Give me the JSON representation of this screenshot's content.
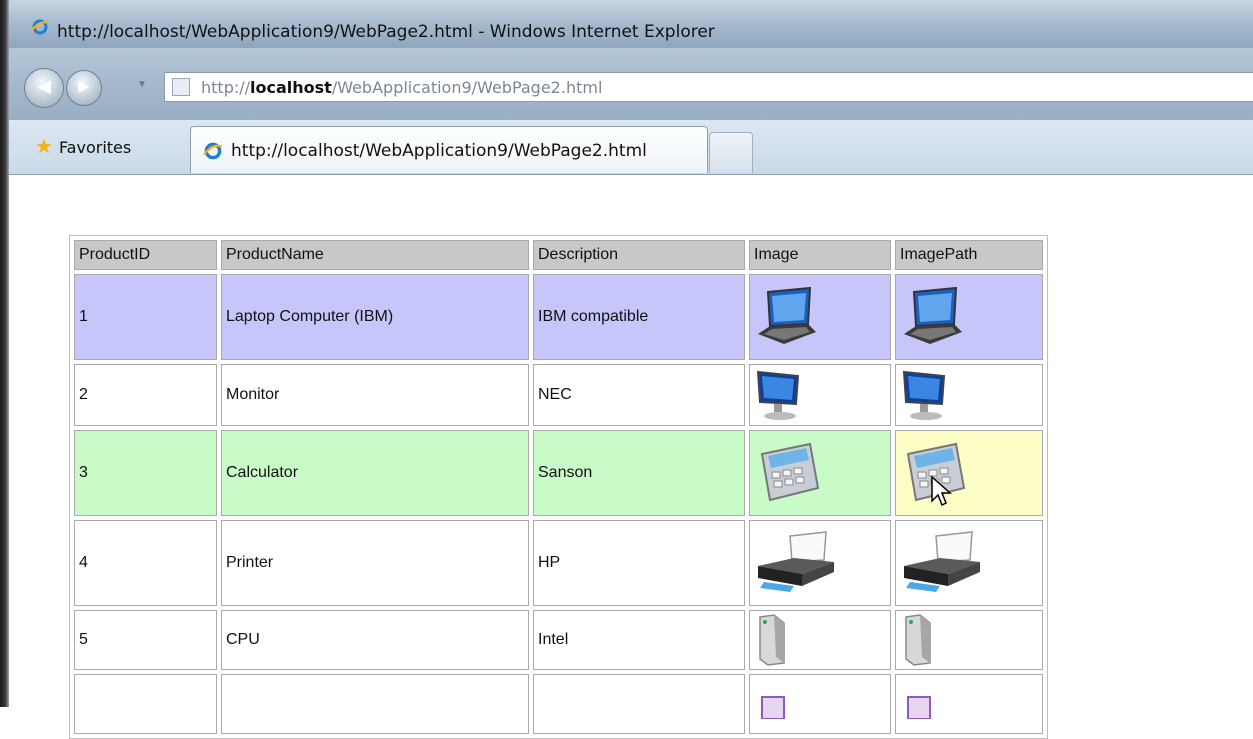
{
  "window": {
    "title": "http://localhost/WebApplication9/WebPage2.html - Windows Internet Explorer"
  },
  "address_bar": {
    "url_prefix": "http://",
    "url_host": "localhost",
    "url_path": "/WebApplication9/WebPage2.html"
  },
  "favorites": {
    "label": "Favorites"
  },
  "tab": {
    "label": "http://localhost/WebApplication9/WebPage2.html"
  },
  "grid": {
    "headers": [
      "ProductID",
      "ProductName",
      "Description",
      "Image",
      "ImagePath"
    ],
    "rows": [
      {
        "id": "1",
        "name": "Laptop Computer (IBM)",
        "description": "IBM compatible",
        "icon": "laptop-icon"
      },
      {
        "id": "2",
        "name": "Monitor",
        "description": "NEC",
        "icon": "monitor-icon"
      },
      {
        "id": "3",
        "name": "Calculator",
        "description": "Sanson",
        "icon": "calculator-icon"
      },
      {
        "id": "4",
        "name": "Printer",
        "description": "HP",
        "icon": "printer-icon"
      },
      {
        "id": "5",
        "name": "CPU",
        "description": "Intel",
        "icon": "cpu-tower-icon"
      },
      {
        "id": "",
        "name": "",
        "description": "",
        "icon": "media-icon"
      }
    ]
  },
  "colors": {
    "selected_row": "#c6c6fb",
    "hover_row": "#c8fbc8",
    "hover_cell": "#fdfdc6",
    "header_bg": "#c8c8c8"
  }
}
